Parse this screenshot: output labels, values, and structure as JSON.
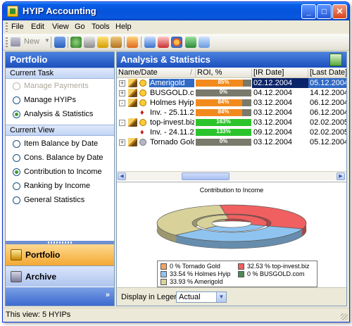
{
  "window": {
    "title": "HYIP Accounting"
  },
  "menu": [
    "File",
    "Edit",
    "View",
    "Go",
    "Tools",
    "Help"
  ],
  "toolbar": {
    "new_label": "New"
  },
  "left": {
    "header": "Portfolio",
    "current_task_title": "Current Task",
    "tasks": [
      {
        "label": "Manage Payments",
        "checked": false,
        "disabled": true
      },
      {
        "label": "Manage HYIPs",
        "checked": false,
        "disabled": false
      },
      {
        "label": "Analysis & Statistics",
        "checked": true,
        "disabled": false
      }
    ],
    "current_view_title": "Current View",
    "views": [
      {
        "label": "Item Balance by Date",
        "checked": false
      },
      {
        "label": "Cons. Balance by Date",
        "checked": false
      },
      {
        "label": "Contribution to Income",
        "checked": true
      },
      {
        "label": "Ranking by Income",
        "checked": false
      },
      {
        "label": "General Statistics",
        "checked": false
      }
    ],
    "nav": [
      {
        "label": "Portfolio",
        "active": true
      },
      {
        "label": "Archive",
        "active": false
      }
    ]
  },
  "right": {
    "header": "Analysis & Statistics",
    "columns": [
      "Name/Date",
      "ROI, %",
      "[IR Date]",
      "[Last Date]"
    ],
    "rows": [
      {
        "expander": "+",
        "type": "hyip",
        "dot": "yellow",
        "name": "Amerigold",
        "roi": "85%",
        "roi_fraction": 0.85,
        "roi_color": "#f28a1e",
        "ir_date": "02.12.2004",
        "last_date": "05.12.2004",
        "selected": true
      },
      {
        "expander": "+",
        "type": "hyip",
        "dot": "yellow",
        "name": "BUSGOLD.c...",
        "roi": "0%",
        "roi_fraction": 0.0,
        "roi_color": "#f28a1e",
        "ir_date": "04.12.2004",
        "last_date": "14.12.2004",
        "selected": false
      },
      {
        "expander": "-",
        "type": "hyip",
        "dot": "yellow",
        "name": "Holmes Hyip",
        "roi": "84%",
        "roi_fraction": 0.84,
        "roi_color": "#f28a1e",
        "ir_date": "03.12.2004",
        "last_date": "06.12.2004",
        "selected": false
      },
      {
        "expander": "",
        "type": "inv",
        "dot": "",
        "name": "Inv. - 25.11.2...",
        "roi": "84%",
        "roi_fraction": 0.84,
        "roi_color": "#f28a1e",
        "ir_date": "03.12.2004",
        "last_date": "06.12.2004",
        "selected": false
      },
      {
        "expander": "-",
        "type": "hyip",
        "dot": "yellow",
        "name": "top-invest.biz",
        "roi": "163%",
        "roi_fraction": 1.0,
        "roi_color": "#2cc42c",
        "ir_date": "03.12.2004",
        "last_date": "02.02.2005",
        "selected": false
      },
      {
        "expander": "",
        "type": "inv",
        "dot": "",
        "name": "Inv. - 24.11.2...",
        "roi": "133%",
        "roi_fraction": 1.0,
        "roi_color": "#2cc42c",
        "ir_date": "09.12.2004",
        "last_date": "02.02.2005",
        "selected": false
      },
      {
        "expander": "+",
        "type": "hyip",
        "dot": "gray",
        "name": "Tornado Gold",
        "roi": "0%",
        "roi_fraction": 0.0,
        "roi_color": "#f28a1e",
        "ir_date": "03.12.2004",
        "last_date": "05.12.2004",
        "selected": false
      }
    ],
    "chart_title": "Contribution to Income",
    "display_in_legend_label": "Display in Legend",
    "display_in_legend_value": "Actual"
  },
  "chart_data": {
    "type": "pie",
    "title": "Contribution to Income",
    "labels": [
      "Tornado Gold",
      "top-invest.biz",
      "Holmes Hyip",
      "BUSGOLD.com",
      "Amerigold"
    ],
    "values": [
      0,
      32.53,
      33.54,
      0,
      33.93
    ],
    "legend_text": [
      "0 % Tornado Gold",
      "32.53 % top-invest.biz",
      "33.54 % Holmes Hyip",
      "0 % BUSGOLD.com",
      "33.93 % Amerigold"
    ],
    "colors": [
      "#f4a460",
      "#f06060",
      "#8fc4f0",
      "#4f8a55",
      "#d8d29a"
    ],
    "legend_placement": "bottom"
  },
  "status": {
    "text": "This view: 5 HYIPs"
  }
}
